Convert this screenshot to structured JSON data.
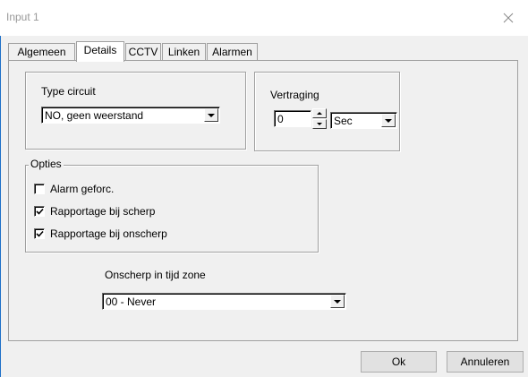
{
  "window": {
    "title": "Input 1"
  },
  "tabs": [
    {
      "label": "Algemeen"
    },
    {
      "label": "Details",
      "active": true
    },
    {
      "label": "CCTV"
    },
    {
      "label": "Linken"
    },
    {
      "label": "Alarmen"
    }
  ],
  "type_circuit": {
    "label": "Type circuit",
    "value": "NO, geen weerstand"
  },
  "vertraging": {
    "label": "Vertraging",
    "value": "0",
    "unit": "Sec"
  },
  "opties": {
    "legend": "Opties",
    "items": [
      {
        "label": "Alarm geforc.",
        "checked": false
      },
      {
        "label": "Rapportage bij scherp",
        "checked": true
      },
      {
        "label": "Rapportage bij onscherp",
        "checked": true
      }
    ]
  },
  "tijdzone": {
    "label": "Onscherp in tijd zone",
    "value": "00 - Never"
  },
  "buttons": {
    "ok": "Ok",
    "cancel": "Annuleren"
  },
  "icons": {
    "close": "close-icon",
    "dropdown": "chevron-down-icon",
    "spin_up": "spin-up-icon",
    "spin_down": "spin-down-icon",
    "check": "checkmark-icon"
  }
}
